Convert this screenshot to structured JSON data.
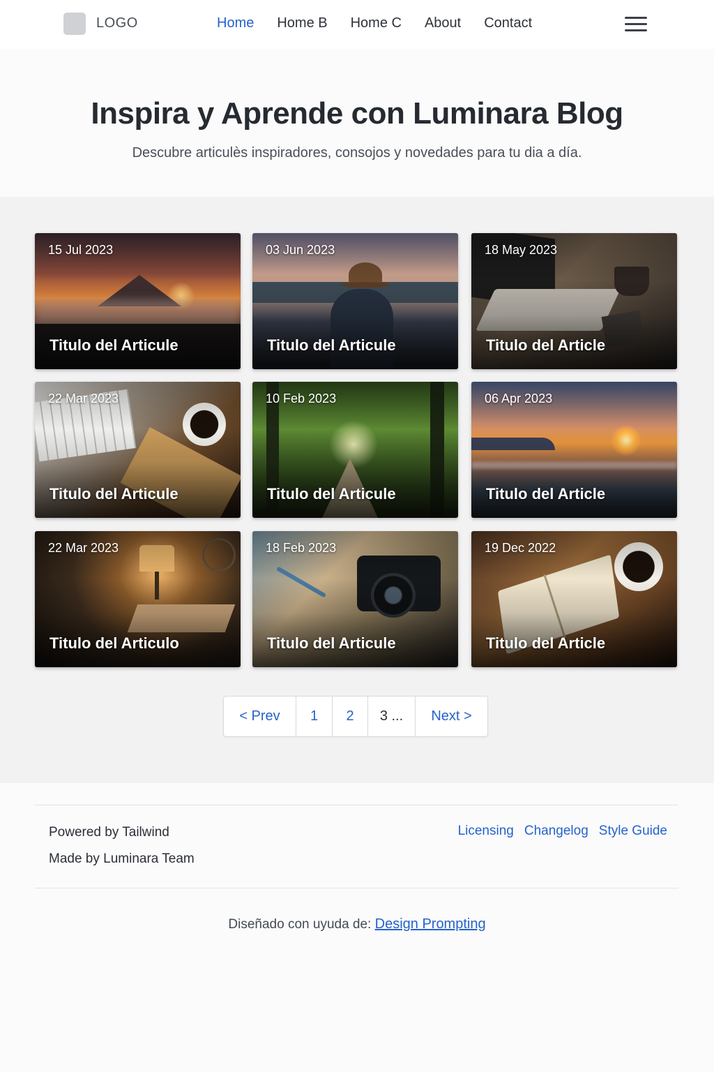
{
  "nav": {
    "logo": "LOGO",
    "links": [
      "Home",
      "Home B",
      "Home C",
      "About",
      "Contact"
    ],
    "active_index": 0,
    "menu_icon": "hamburger-menu-icon"
  },
  "hero": {
    "title": "Inspira y Aprende con Luminara Blog",
    "subtitle": "Descubre articulès inspiradores, consojos y novedades para tu dia a día."
  },
  "cards": [
    {
      "date": "15 Jul 2023",
      "title": "Titulo del Articule",
      "image": "mountain-sunrise"
    },
    {
      "date": "03 Jun 2023",
      "title": "Titulo del Articule",
      "image": "hiker-lake"
    },
    {
      "date": "18 May 2023",
      "title": "Titulo del Article",
      "image": "laptop-coffee"
    },
    {
      "date": "22 Mar 2023",
      "title": "Titulo del Articule",
      "image": "keyboard-coffee-notebook"
    },
    {
      "date": "10 Feb 2023",
      "title": "Titulo del Articule",
      "image": "forest-path"
    },
    {
      "date": "06 Apr 2023",
      "title": "Titulo del Article",
      "image": "beach-sunset"
    },
    {
      "date": "22 Mar 2023",
      "title": "Titulo del Articulo",
      "image": "desk-lamp"
    },
    {
      "date": "18 Feb 2023",
      "title": "Titulo del Articule",
      "image": "camera-map"
    },
    {
      "date": "19 Dec 2022",
      "title": "Titulo del Article",
      "image": "book-coffee"
    }
  ],
  "pagination": {
    "prev": "< Prev",
    "pages": [
      "1",
      "2",
      "3 ..."
    ],
    "next": "Next >"
  },
  "footer": {
    "powered": "Powered by Tailwind",
    "made": "Made by Luminara Team",
    "links": [
      "Licensing",
      "Changelog",
      "Style Guide"
    ],
    "credit_prefix": "Diseñado con uyuda de:",
    "credit_link": "Design Prompting"
  },
  "colors": {
    "accent": "#2563c9",
    "text": "#2b2f36",
    "background": "#f2f2f3"
  }
}
